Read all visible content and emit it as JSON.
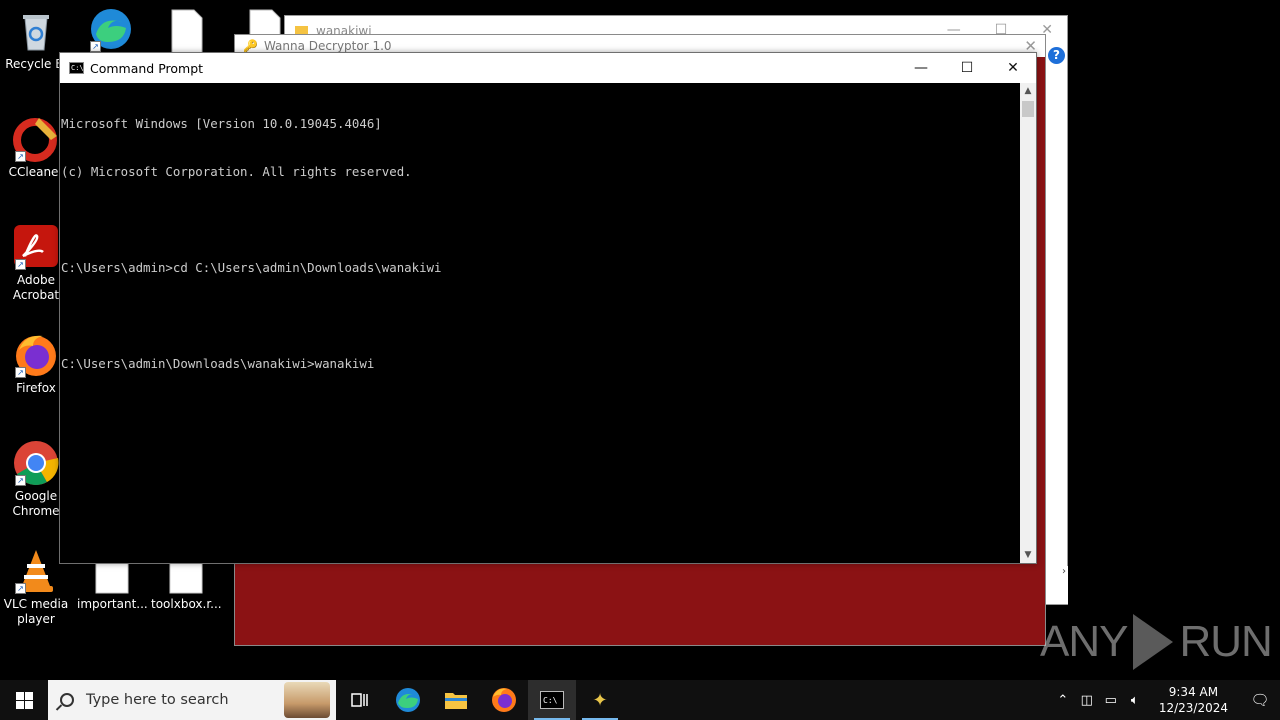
{
  "desktop": {
    "icons": [
      {
        "label": "Recycle Bi",
        "icon": "recycle-bin-icon"
      },
      {
        "label": "CCleaner",
        "icon": "ccleaner-icon"
      },
      {
        "label": "Adobe Acrobat",
        "icon": "adobe-acrobat-icon"
      },
      {
        "label": "Firefox",
        "icon": "firefox-icon"
      },
      {
        "label": "Google Chrome",
        "icon": "chrome-icon"
      },
      {
        "label": "VLC media player",
        "icon": "vlc-icon"
      },
      {
        "label": "important...",
        "icon": "file-icon"
      },
      {
        "label": "toolxbox.r...",
        "icon": "file-icon"
      }
    ]
  },
  "explorer": {
    "title": "wanakiwi"
  },
  "wanna": {
    "title": "Wanna Decryptor 1.0",
    "accent": "#8b1214"
  },
  "cmd": {
    "title": "Command Prompt",
    "lines": [
      "Microsoft Windows [Version 10.0.19045.4046]",
      "(c) Microsoft Corporation. All rights reserved.",
      "",
      "C:\\Users\\admin>cd C:\\Users\\admin\\Downloads\\wanakiwi",
      "",
      "C:\\Users\\admin\\Downloads\\wanakiwi>wanakiwi"
    ]
  },
  "watermark": {
    "left": "ANY",
    "right": "RUN"
  },
  "taskbar": {
    "search_placeholder": "Type here to search",
    "apps": [
      "task-view-icon",
      "edge-icon",
      "file-explorer-icon",
      "firefox-icon",
      "command-prompt-icon",
      "wanna-decryptor-icon"
    ],
    "time": "9:34 AM",
    "date": "12/23/2024"
  },
  "colors": {
    "taskbar": "#101010",
    "cmd_bg": "#000000",
    "cmd_text": "#cccccc"
  }
}
